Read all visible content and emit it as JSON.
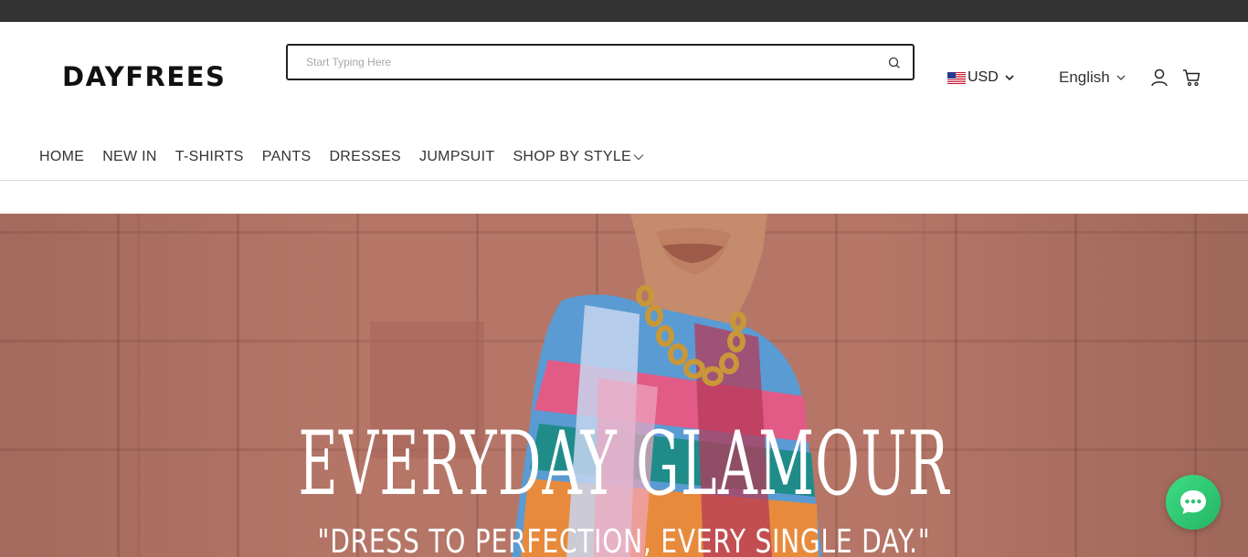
{
  "brand": {
    "logo_text": "DAYFREES"
  },
  "search": {
    "placeholder": "Start Typing Here",
    "value": "",
    "icon": "search-icon"
  },
  "currency": {
    "label": "USD",
    "flag_icon": "us-flag-icon"
  },
  "language": {
    "label": "English"
  },
  "header_icons": {
    "account": "user-icon",
    "cart": "cart-icon"
  },
  "nav": {
    "items": [
      {
        "label": "HOME"
      },
      {
        "label": "NEW IN"
      },
      {
        "label": "T-SHIRTS"
      },
      {
        "label": "PANTS"
      },
      {
        "label": "DRESSES"
      },
      {
        "label": "JUMPSUIT"
      },
      {
        "label": "SHOP BY STYLE",
        "icon": "chevron-down-icon"
      }
    ]
  },
  "hero": {
    "title": "EVERYDAY GLAMOUR",
    "subtitle": "\"DRESS TO PERFECTION, EVERY SINGLE DAY.\""
  },
  "chat": {
    "icon": "chat-bubble-icon",
    "color": "#35c878"
  },
  "colors": {
    "topbar": "#333333",
    "text": "#222222",
    "hero_bg": "#b57667"
  }
}
